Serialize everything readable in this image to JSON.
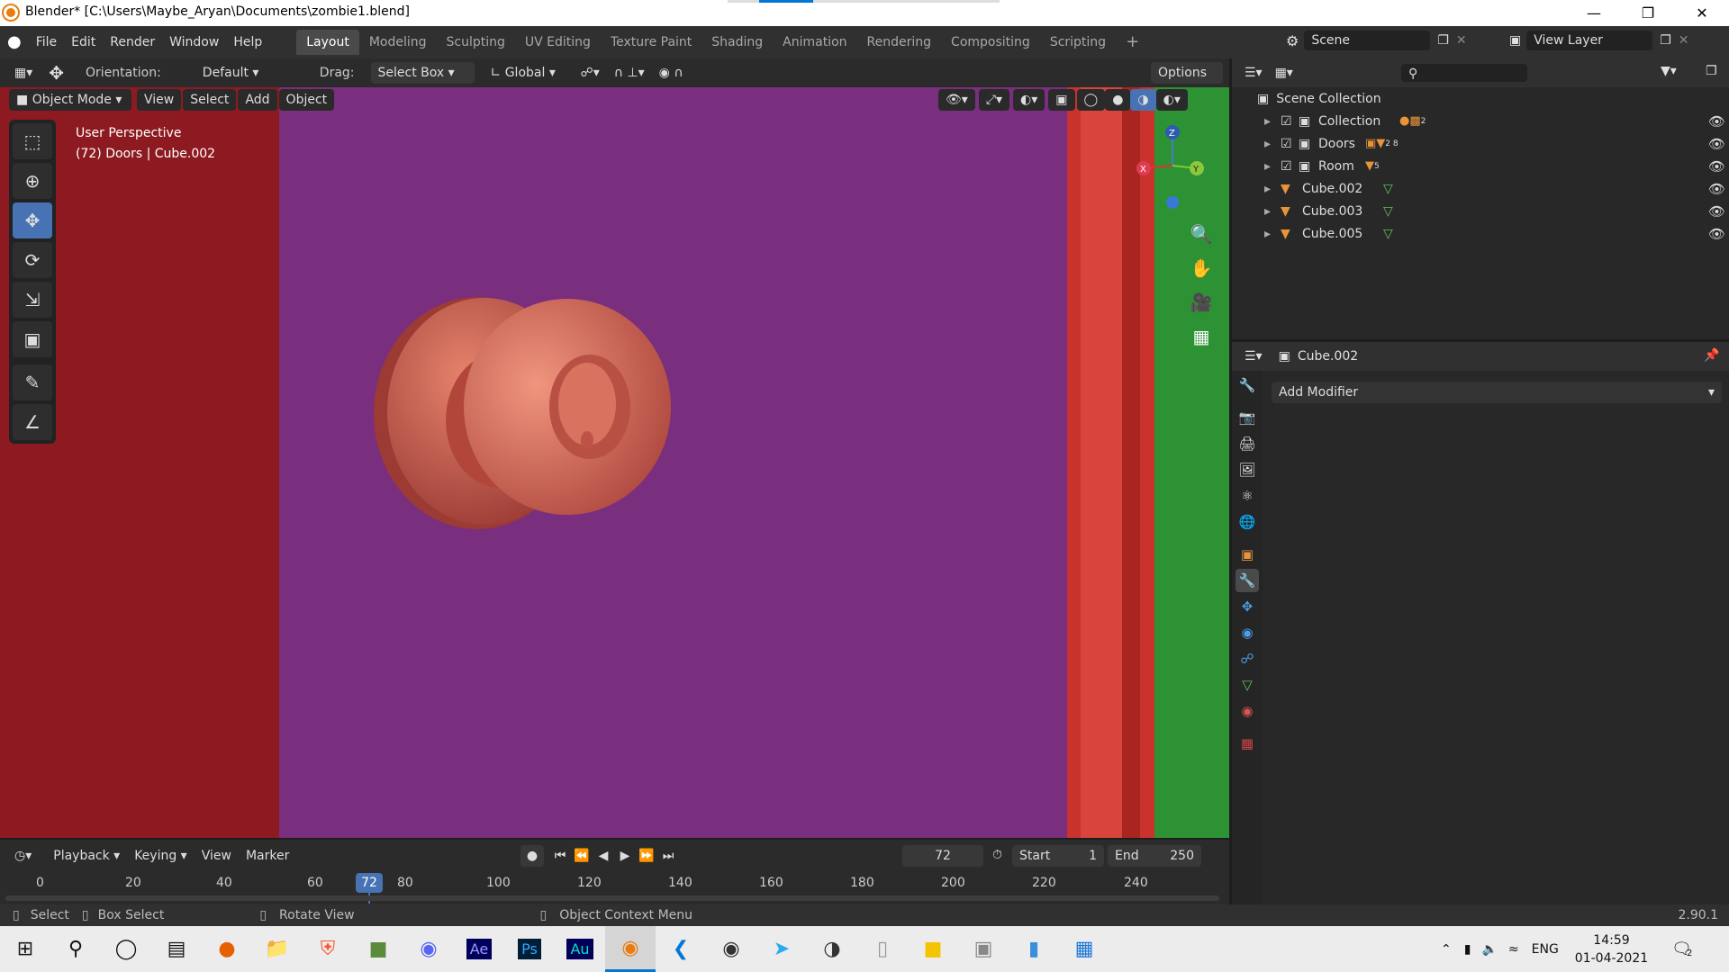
{
  "window": {
    "title": "Blender* [C:\\Users\\Maybe_Aryan\\Documents\\zombie1.blend]"
  },
  "menu": [
    "File",
    "Edit",
    "Render",
    "Window",
    "Help"
  ],
  "workspaces": [
    "Layout",
    "Modeling",
    "Sculpting",
    "UV Editing",
    "Texture Paint",
    "Shading",
    "Animation",
    "Rendering",
    "Compositing",
    "Scripting"
  ],
  "scene": {
    "label": "Scene"
  },
  "view_layer": {
    "label": "View Layer"
  },
  "tool_header": {
    "orientation_label": "Orientation:",
    "orientation_value": "Default",
    "drag_label": "Drag:",
    "drag_value": "Select Box",
    "transform_value": "Global",
    "options": "Options"
  },
  "viewport_header": {
    "mode": "Object Mode",
    "view": "View",
    "select": "Select",
    "add": "Add",
    "object": "Object"
  },
  "viewport": {
    "perspective": "User Perspective",
    "info": "(72) Doors | Cube.002"
  },
  "gizmo": {
    "x": "X",
    "y": "Y",
    "z": "Z"
  },
  "timeline": {
    "playback": "Playback",
    "keying": "Keying",
    "view": "View",
    "marker": "Marker",
    "current_frame": "72",
    "start_label": "Start",
    "start": "1",
    "end_label": "End",
    "end": "250",
    "ticks": [
      "0",
      "20",
      "40",
      "60",
      "72",
      "80",
      "100",
      "120",
      "140",
      "160",
      "180",
      "200",
      "220",
      "240"
    ]
  },
  "outliner": {
    "root": "Scene Collection",
    "items": [
      {
        "name": "Collection",
        "badge": "2"
      },
      {
        "name": "Doors",
        "badge": "2 8"
      },
      {
        "name": "Room",
        "badge": "5"
      },
      {
        "name": "Cube.002",
        "badge": ""
      },
      {
        "name": "Cube.003",
        "badge": ""
      },
      {
        "name": "Cube.005",
        "badge": ""
      }
    ]
  },
  "properties": {
    "object": "Cube.002",
    "add_modifier": "Add Modifier"
  },
  "statusbar": {
    "select": "Select",
    "box_select": "Box Select",
    "rotate": "Rotate View",
    "context": "Object Context Menu",
    "version": "2.90.1"
  },
  "taskbar": {
    "lang": "ENG",
    "time": "14:59",
    "date": "01-04-2021",
    "notif": "2"
  },
  "colors": {
    "accent": "#4772b3",
    "wall_left": "#8c1a20",
    "wall_purple": "#7a2e7e",
    "wall_red": "#c9322d",
    "wall_green": "#2d9234",
    "knob": "#d46a55"
  }
}
